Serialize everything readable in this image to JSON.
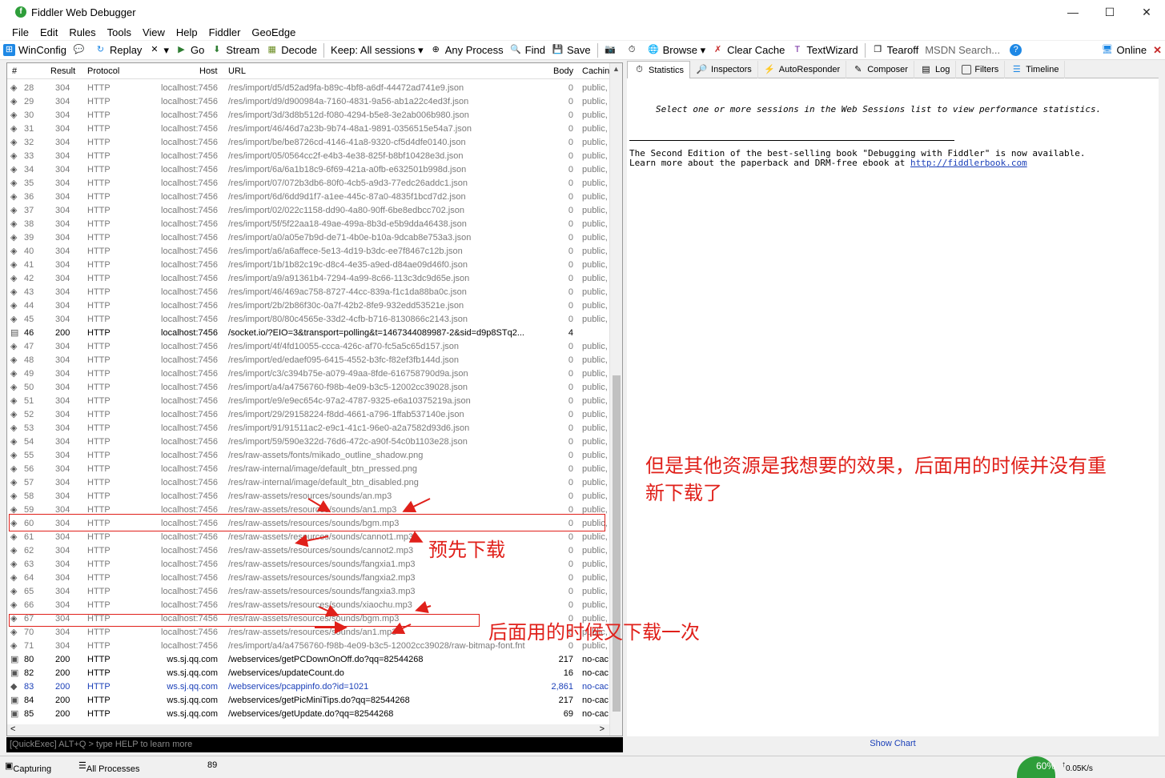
{
  "window": {
    "title": "Fiddler Web Debugger"
  },
  "menu": [
    "File",
    "Edit",
    "Rules",
    "Tools",
    "View",
    "Help",
    "Fiddler",
    "GeoEdge"
  ],
  "toolbar": {
    "winconfig": "WinConfig",
    "replay": "Replay",
    "go": "Go",
    "stream": "Stream",
    "decode": "Decode",
    "keep": "Keep: All sessions",
    "any_process": "Any Process",
    "find": "Find",
    "save": "Save",
    "browse": "Browse",
    "clear_cache": "Clear Cache",
    "textwizard": "TextWizard",
    "tearoff": "Tearoff",
    "msdn": "MSDN Search...",
    "online": "Online"
  },
  "tabs": [
    "Statistics",
    "Inspectors",
    "AutoResponder",
    "Composer",
    "Log",
    "Filters",
    "Timeline"
  ],
  "statistics": {
    "hint": "Select one or more sessions in the Web Sessions list to view performance statistics.",
    "promo1": "The Second Edition of the best-selling book \"Debugging with Fiddler\" is now available.",
    "promo2": "Learn more about the paperback and DRM-free ebook at",
    "link": "http://fiddlerbook.com",
    "show_chart": "Show Chart"
  },
  "quickexec": {
    "placeholder": "[QuickExec] ALT+Q > type HELP to learn more"
  },
  "status": {
    "capturing": "Capturing",
    "processes": "All Processes",
    "count": "89",
    "gauge": "60%",
    "speed": "0.05K/s"
  },
  "annotations": {
    "note1_line1": "但是其他资源是我想要的效果，后面用的时候并没有重",
    "note1_line2": "新下载了",
    "preload": "预先下载",
    "redownload": "后面用的时候又下载一次"
  },
  "sessions": {
    "columns": [
      "#",
      "Result",
      "Protocol",
      "Host",
      "URL",
      "Body",
      "Cachin"
    ],
    "rows": [
      {
        "num": "28",
        "result": "304",
        "protocol": "HTTP",
        "host": "localhost:7456",
        "url": "/res/import/d5/d52ad9fa-b89c-4bf8-a6df-44472ad741e9.json",
        "body": "0",
        "caching": "public,",
        "style": "cached"
      },
      {
        "num": "29",
        "result": "304",
        "protocol": "HTTP",
        "host": "localhost:7456",
        "url": "/res/import/d9/d900984a-7160-4831-9a56-ab1a22c4ed3f.json",
        "body": "0",
        "caching": "public,",
        "style": "cached"
      },
      {
        "num": "30",
        "result": "304",
        "protocol": "HTTP",
        "host": "localhost:7456",
        "url": "/res/import/3d/3d8b512d-f080-4294-b5e8-3e2ab006b980.json",
        "body": "0",
        "caching": "public,",
        "style": "cached"
      },
      {
        "num": "31",
        "result": "304",
        "protocol": "HTTP",
        "host": "localhost:7456",
        "url": "/res/import/46/46d7a23b-9b74-48a1-9891-0356515e54a7.json",
        "body": "0",
        "caching": "public,",
        "style": "cached"
      },
      {
        "num": "32",
        "result": "304",
        "protocol": "HTTP",
        "host": "localhost:7456",
        "url": "/res/import/be/be8726cd-4146-41a8-9320-cf5d4dfe0140.json",
        "body": "0",
        "caching": "public,",
        "style": "cached"
      },
      {
        "num": "33",
        "result": "304",
        "protocol": "HTTP",
        "host": "localhost:7456",
        "url": "/res/import/05/0564cc2f-e4b3-4e38-825f-b8bf10428e3d.json",
        "body": "0",
        "caching": "public,",
        "style": "cached"
      },
      {
        "num": "34",
        "result": "304",
        "protocol": "HTTP",
        "host": "localhost:7456",
        "url": "/res/import/6a/6a1b18c9-6f69-421a-a0fb-e632501b998d.json",
        "body": "0",
        "caching": "public,",
        "style": "cached"
      },
      {
        "num": "35",
        "result": "304",
        "protocol": "HTTP",
        "host": "localhost:7456",
        "url": "/res/import/07/072b3db6-80f0-4cb5-a9d3-77edc26addc1.json",
        "body": "0",
        "caching": "public,",
        "style": "cached"
      },
      {
        "num": "36",
        "result": "304",
        "protocol": "HTTP",
        "host": "localhost:7456",
        "url": "/res/import/6d/6dd9d1f7-a1ee-445c-87a0-4835f1bcd7d2.json",
        "body": "0",
        "caching": "public,",
        "style": "cached"
      },
      {
        "num": "37",
        "result": "304",
        "protocol": "HTTP",
        "host": "localhost:7456",
        "url": "/res/import/02/022c1158-dd90-4a80-90ff-6be8edbcc702.json",
        "body": "0",
        "caching": "public,",
        "style": "cached"
      },
      {
        "num": "38",
        "result": "304",
        "protocol": "HTTP",
        "host": "localhost:7456",
        "url": "/res/import/5f/5f22aa18-49ae-499a-8b3d-e5b9dda46438.json",
        "body": "0",
        "caching": "public,",
        "style": "cached"
      },
      {
        "num": "39",
        "result": "304",
        "protocol": "HTTP",
        "host": "localhost:7456",
        "url": "/res/import/a0/a05e7b9d-de71-4b0e-b10a-9dcab8e753a3.json",
        "body": "0",
        "caching": "public,",
        "style": "cached"
      },
      {
        "num": "40",
        "result": "304",
        "protocol": "HTTP",
        "host": "localhost:7456",
        "url": "/res/import/a6/a6affece-5e13-4d19-b3dc-ee7f8467c12b.json",
        "body": "0",
        "caching": "public,",
        "style": "cached"
      },
      {
        "num": "41",
        "result": "304",
        "protocol": "HTTP",
        "host": "localhost:7456",
        "url": "/res/import/1b/1b82c19c-d8c4-4e35-a9ed-d84ae09d46f0.json",
        "body": "0",
        "caching": "public,",
        "style": "cached"
      },
      {
        "num": "42",
        "result": "304",
        "protocol": "HTTP",
        "host": "localhost:7456",
        "url": "/res/import/a9/a91361b4-7294-4a99-8c66-113c3dc9d65e.json",
        "body": "0",
        "caching": "public,",
        "style": "cached"
      },
      {
        "num": "43",
        "result": "304",
        "protocol": "HTTP",
        "host": "localhost:7456",
        "url": "/res/import/46/469ac758-8727-44cc-839a-f1c1da88ba0c.json",
        "body": "0",
        "caching": "public,",
        "style": "cached"
      },
      {
        "num": "44",
        "result": "304",
        "protocol": "HTTP",
        "host": "localhost:7456",
        "url": "/res/import/2b/2b86f30c-0a7f-42b2-8fe9-932edd53521e.json",
        "body": "0",
        "caching": "public,",
        "style": "cached"
      },
      {
        "num": "45",
        "result": "304",
        "protocol": "HTTP",
        "host": "localhost:7456",
        "url": "/res/import/80/80c4565e-33d2-4cfb-b716-8130866c2143.json",
        "body": "0",
        "caching": "public,",
        "style": "cached"
      },
      {
        "num": "46",
        "result": "200",
        "protocol": "HTTP",
        "host": "localhost:7456",
        "url": "/socket.io/?EIO=3&transport=polling&t=1467344089987-2&sid=d9p8STq2...",
        "body": "4",
        "caching": "",
        "style": "dark"
      },
      {
        "num": "47",
        "result": "304",
        "protocol": "HTTP",
        "host": "localhost:7456",
        "url": "/res/import/4f/4fd10055-ccca-426c-af70-fc5a5c65d157.json",
        "body": "0",
        "caching": "public,",
        "style": "cached"
      },
      {
        "num": "48",
        "result": "304",
        "protocol": "HTTP",
        "host": "localhost:7456",
        "url": "/res/import/ed/edaef095-6415-4552-b3fc-f82ef3fb144d.json",
        "body": "0",
        "caching": "public,",
        "style": "cached"
      },
      {
        "num": "49",
        "result": "304",
        "protocol": "HTTP",
        "host": "localhost:7456",
        "url": "/res/import/c3/c394b75e-a079-49aa-8fde-616758790d9a.json",
        "body": "0",
        "caching": "public,",
        "style": "cached"
      },
      {
        "num": "50",
        "result": "304",
        "protocol": "HTTP",
        "host": "localhost:7456",
        "url": "/res/import/a4/a4756760-f98b-4e09-b3c5-12002cc39028.json",
        "body": "0",
        "caching": "public,",
        "style": "cached"
      },
      {
        "num": "51",
        "result": "304",
        "protocol": "HTTP",
        "host": "localhost:7456",
        "url": "/res/import/e9/e9ec654c-97a2-4787-9325-e6a10375219a.json",
        "body": "0",
        "caching": "public,",
        "style": "cached"
      },
      {
        "num": "52",
        "result": "304",
        "protocol": "HTTP",
        "host": "localhost:7456",
        "url": "/res/import/29/29158224-f8dd-4661-a796-1ffab537140e.json",
        "body": "0",
        "caching": "public,",
        "style": "cached"
      },
      {
        "num": "53",
        "result": "304",
        "protocol": "HTTP",
        "host": "localhost:7456",
        "url": "/res/import/91/91511ac2-e9c1-41c1-96e0-a2a7582d93d6.json",
        "body": "0",
        "caching": "public,",
        "style": "cached"
      },
      {
        "num": "54",
        "result": "304",
        "protocol": "HTTP",
        "host": "localhost:7456",
        "url": "/res/import/59/590e322d-76d6-472c-a90f-54c0b1103e28.json",
        "body": "0",
        "caching": "public,",
        "style": "cached"
      },
      {
        "num": "55",
        "result": "304",
        "protocol": "HTTP",
        "host": "localhost:7456",
        "url": "/res/raw-assets/fonts/mikado_outline_shadow.png",
        "body": "0",
        "caching": "public,",
        "style": "cached"
      },
      {
        "num": "56",
        "result": "304",
        "protocol": "HTTP",
        "host": "localhost:7456",
        "url": "/res/raw-internal/image/default_btn_pressed.png",
        "body": "0",
        "caching": "public,",
        "style": "cached"
      },
      {
        "num": "57",
        "result": "304",
        "protocol": "HTTP",
        "host": "localhost:7456",
        "url": "/res/raw-internal/image/default_btn_disabled.png",
        "body": "0",
        "caching": "public,",
        "style": "cached"
      },
      {
        "num": "58",
        "result": "304",
        "protocol": "HTTP",
        "host": "localhost:7456",
        "url": "/res/raw-assets/resources/sounds/an.mp3",
        "body": "0",
        "caching": "public,",
        "style": "cached"
      },
      {
        "num": "59",
        "result": "304",
        "protocol": "HTTP",
        "host": "localhost:7456",
        "url": "/res/raw-assets/resources/sounds/an1.mp3",
        "body": "0",
        "caching": "public,",
        "style": "cached"
      },
      {
        "num": "60",
        "result": "304",
        "protocol": "HTTP",
        "host": "localhost:7456",
        "url": "/res/raw-assets/resources/sounds/bgm.mp3",
        "body": "0",
        "caching": "public,",
        "style": "cached"
      },
      {
        "num": "61",
        "result": "304",
        "protocol": "HTTP",
        "host": "localhost:7456",
        "url": "/res/raw-assets/resources/sounds/cannot1.mp3",
        "body": "0",
        "caching": "public,",
        "style": "cached"
      },
      {
        "num": "62",
        "result": "304",
        "protocol": "HTTP",
        "host": "localhost:7456",
        "url": "/res/raw-assets/resources/sounds/cannot2.mp3",
        "body": "0",
        "caching": "public,",
        "style": "cached"
      },
      {
        "num": "63",
        "result": "304",
        "protocol": "HTTP",
        "host": "localhost:7456",
        "url": "/res/raw-assets/resources/sounds/fangxia1.mp3",
        "body": "0",
        "caching": "public,",
        "style": "cached"
      },
      {
        "num": "64",
        "result": "304",
        "protocol": "HTTP",
        "host": "localhost:7456",
        "url": "/res/raw-assets/resources/sounds/fangxia2.mp3",
        "body": "0",
        "caching": "public,",
        "style": "cached"
      },
      {
        "num": "65",
        "result": "304",
        "protocol": "HTTP",
        "host": "localhost:7456",
        "url": "/res/raw-assets/resources/sounds/fangxia3.mp3",
        "body": "0",
        "caching": "public,",
        "style": "cached"
      },
      {
        "num": "66",
        "result": "304",
        "protocol": "HTTP",
        "host": "localhost:7456",
        "url": "/res/raw-assets/resources/sounds/xiaochu.mp3",
        "body": "0",
        "caching": "public,",
        "style": "cached"
      },
      {
        "num": "67",
        "result": "304",
        "protocol": "HTTP",
        "host": "localhost:7456",
        "url": "/res/raw-assets/resources/sounds/bgm.mp3",
        "body": "0",
        "caching": "public,",
        "style": "cached"
      },
      {
        "num": "70",
        "result": "304",
        "protocol": "HTTP",
        "host": "localhost:7456",
        "url": "/res/raw-assets/resources/sounds/an1.mp3",
        "body": "0",
        "caching": "public,",
        "style": "cached"
      },
      {
        "num": "71",
        "result": "304",
        "protocol": "HTTP",
        "host": "localhost:7456",
        "url": "/res/import/a4/a4756760-f98b-4e09-b3c5-12002cc39028/raw-bitmap-font.fnt",
        "body": "0",
        "caching": "public,",
        "style": "cached"
      },
      {
        "num": "80",
        "result": "200",
        "protocol": "HTTP",
        "host": "ws.sj.qq.com",
        "url": "/webservices/getPCDownOnOff.do?qq=82544268",
        "body": "217",
        "caching": "no-cac",
        "style": "dark"
      },
      {
        "num": "82",
        "result": "200",
        "protocol": "HTTP",
        "host": "ws.sj.qq.com",
        "url": "/webservices/updateCount.do",
        "body": "16",
        "caching": "no-cac",
        "style": "dark"
      },
      {
        "num": "83",
        "result": "200",
        "protocol": "HTTP",
        "host": "ws.sj.qq.com",
        "url": "/webservices/pcappinfo.do?id=1021",
        "body": "2,861",
        "caching": "no-cac",
        "style": "blue"
      },
      {
        "num": "84",
        "result": "200",
        "protocol": "HTTP",
        "host": "ws.sj.qq.com",
        "url": "/webservices/getPicMiniTips.do?qq=82544268",
        "body": "217",
        "caching": "no-cac",
        "style": "dark"
      },
      {
        "num": "85",
        "result": "200",
        "protocol": "HTTP",
        "host": "ws.sj.qq.com",
        "url": "/webservices/getUpdate.do?qq=82544268",
        "body": "69",
        "caching": "no-cac",
        "style": "dark"
      }
    ]
  }
}
